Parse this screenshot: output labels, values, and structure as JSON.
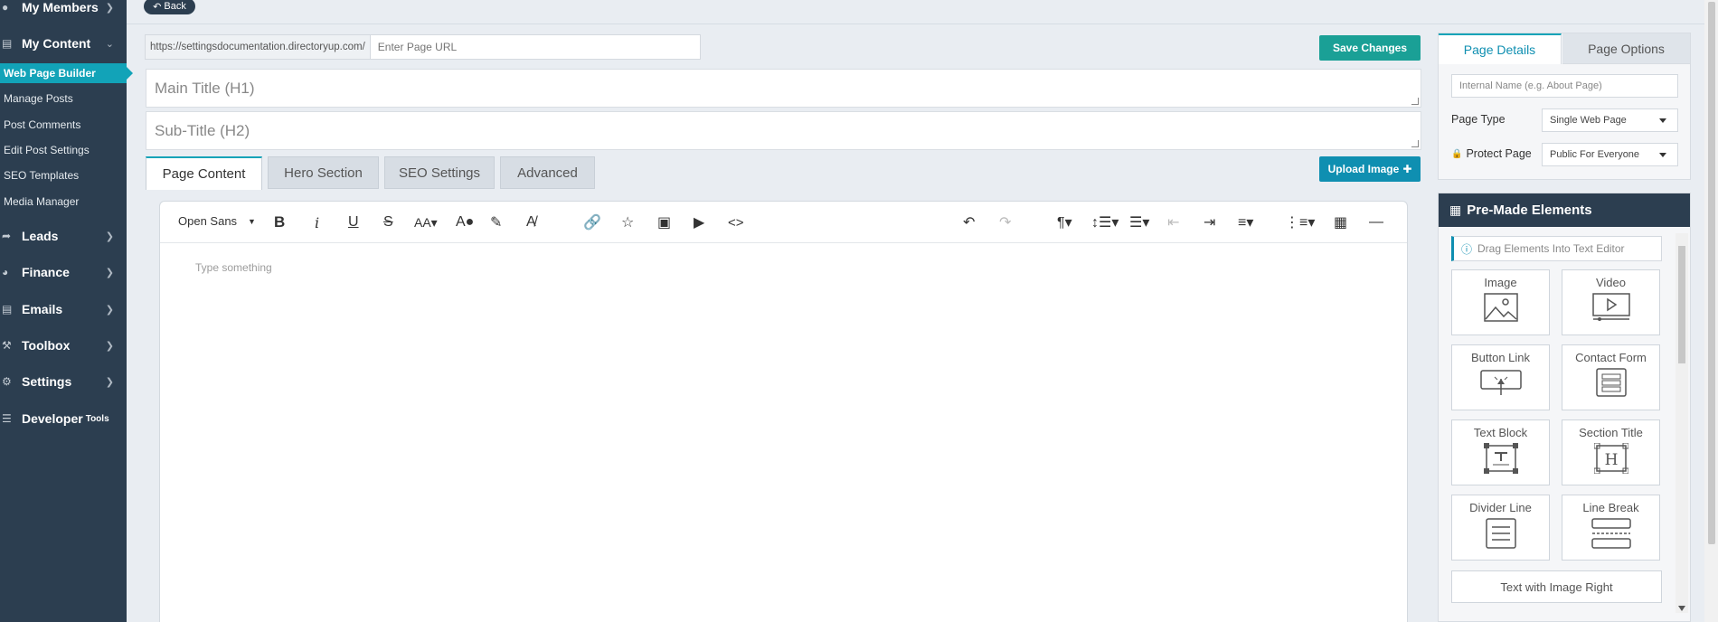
{
  "sidebar": {
    "my_members": "My Members",
    "my_content": "My Content",
    "sub_items": [
      "Web Page Builder",
      "Manage Posts",
      "Post Comments",
      "Edit Post Settings",
      "SEO Templates",
      "Media Manager"
    ],
    "leads": "Leads",
    "finance": "Finance",
    "emails": "Emails",
    "toolbox": "Toolbox",
    "settings": "Settings",
    "developer": "Developer",
    "developer_tools": "Tools"
  },
  "header": {
    "back_label": "Back",
    "url_prefix": "https://settingsdocumentation.directoryup.com/",
    "url_placeholder": "Enter Page URL",
    "save_label": "Save Changes"
  },
  "form": {
    "main_title_placeholder": "Main Title (H1)",
    "sub_title_placeholder": "Sub-Title (H2)",
    "upload_label": "Upload Image",
    "tabs": [
      "Page Content",
      "Hero Section",
      "SEO Settings",
      "Advanced"
    ]
  },
  "editor": {
    "font": "Open Sans",
    "placeholder": "Type something"
  },
  "details": {
    "tabs": [
      "Page Details",
      "Page Options"
    ],
    "internal_name_placeholder": "Internal Name (e.g. About Page)",
    "page_type_label": "Page Type",
    "page_type_value": "Single Web Page",
    "protect_label": "Protect Page",
    "protect_value": "Public For Everyone"
  },
  "premade": {
    "title": "Pre-Made Elements",
    "hint": "Drag Elements Into Text Editor",
    "items": [
      "Image",
      "Video",
      "Button Link",
      "Contact Form",
      "Text Block",
      "Section Title",
      "Divider Line",
      "Line Break"
    ],
    "wide_item": "Text with Image Right"
  },
  "colors": {
    "sidebar_bg": "#2c3e50",
    "accent_teal": "#12a3b8",
    "save_green": "#1aa096",
    "upload_blue": "#0f8fb1"
  }
}
